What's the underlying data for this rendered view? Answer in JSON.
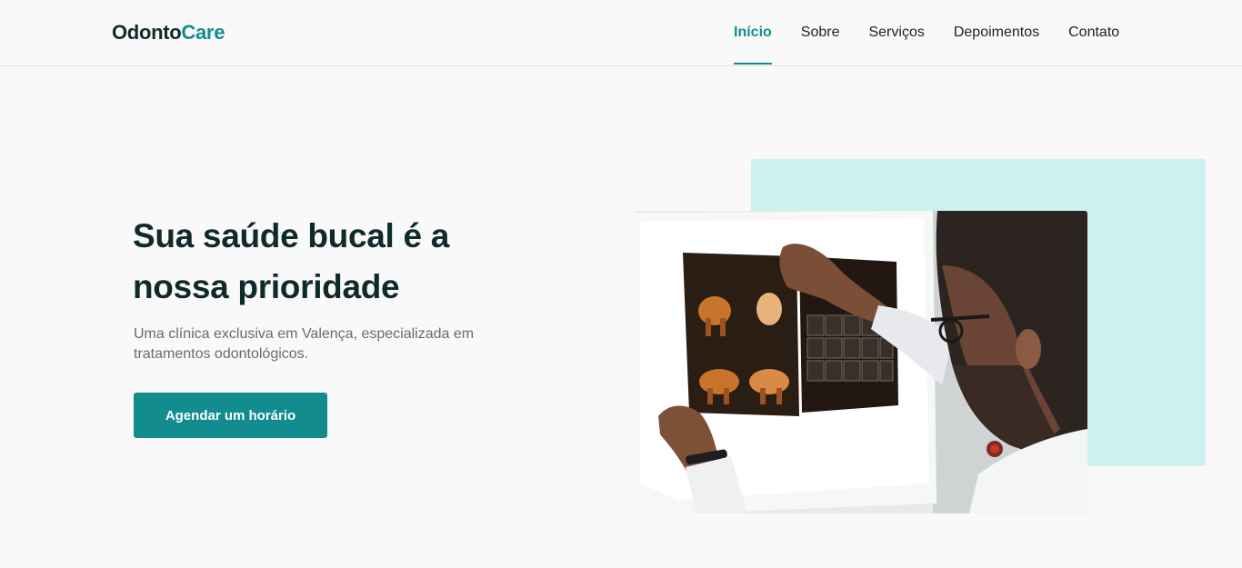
{
  "brand": {
    "name_part1": "Odonto",
    "name_part2": "Care",
    "accent_color": "#128c8f"
  },
  "nav": {
    "items": [
      {
        "label": "Início",
        "active": true
      },
      {
        "label": "Sobre",
        "active": false
      },
      {
        "label": "Serviços",
        "active": false
      },
      {
        "label": "Depoimentos",
        "active": false
      },
      {
        "label": "Contato",
        "active": false
      }
    ]
  },
  "hero": {
    "title_line1": "Sua saúde bucal é a",
    "title_line2": "nossa prioridade",
    "subtitle": "Uma clínica exclusiva em Valença, especializada em tratamentos odontológicos.",
    "cta_label": "Agendar um horário",
    "image_subject": "dentist examining dental x-rays on a light box",
    "accent_block_color": "#cdf1f1"
  }
}
